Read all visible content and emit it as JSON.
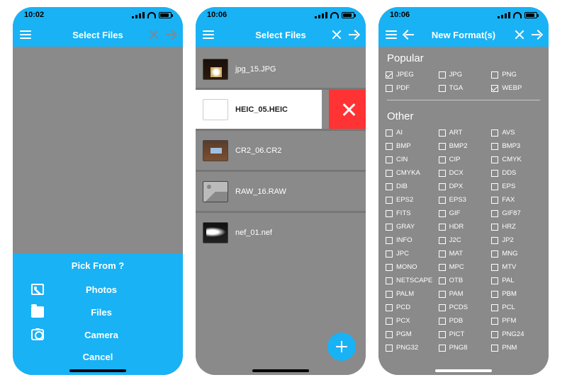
{
  "colors": {
    "accent": "#19b2f5",
    "danger": "#f33",
    "bg": "#8a8a8a"
  },
  "phone1": {
    "time": "10:02",
    "title": "Select Files",
    "sheet": {
      "title": "Pick From ?",
      "photos": "Photos",
      "files": "Files",
      "camera": "Camera",
      "cancel": "Cancel"
    }
  },
  "phone2": {
    "time": "10:06",
    "title": "Select Files",
    "files": [
      {
        "name": "jpg_15.JPG",
        "thumb": "t1"
      },
      {
        "name": "HEIC_05.HEIC",
        "thumb": "white",
        "swiped": true
      },
      {
        "name": "CR2_06.CR2",
        "thumb": "t3"
      },
      {
        "name": "RAW_16.RAW",
        "thumb": "placeholder"
      },
      {
        "name": "nef_01.nef",
        "thumb": "t5"
      }
    ]
  },
  "phone3": {
    "time": "10:06",
    "title": "New Format(s)",
    "section_popular": "Popular",
    "section_other": "Other",
    "popular": [
      {
        "label": "JPEG",
        "checked": true
      },
      {
        "label": "JPG",
        "checked": false
      },
      {
        "label": "PNG",
        "checked": false
      },
      {
        "label": "PDF",
        "checked": false
      },
      {
        "label": "TGA",
        "checked": false
      },
      {
        "label": "WEBP",
        "checked": true
      }
    ],
    "other": [
      {
        "label": "AI"
      },
      {
        "label": "ART"
      },
      {
        "label": "AVS"
      },
      {
        "label": "BMP"
      },
      {
        "label": "BMP2"
      },
      {
        "label": "BMP3"
      },
      {
        "label": "CIN"
      },
      {
        "label": "CIP"
      },
      {
        "label": "CMYK"
      },
      {
        "label": "CMYKA"
      },
      {
        "label": "DCX"
      },
      {
        "label": "DDS"
      },
      {
        "label": "DIB"
      },
      {
        "label": "DPX"
      },
      {
        "label": "EPS"
      },
      {
        "label": "EPS2"
      },
      {
        "label": "EPS3"
      },
      {
        "label": "FAX"
      },
      {
        "label": "FITS"
      },
      {
        "label": "GIF"
      },
      {
        "label": "GIF87"
      },
      {
        "label": "GRAY"
      },
      {
        "label": "HDR"
      },
      {
        "label": "HRZ"
      },
      {
        "label": "INFO"
      },
      {
        "label": "J2C"
      },
      {
        "label": "JP2"
      },
      {
        "label": "JPC"
      },
      {
        "label": "MAT"
      },
      {
        "label": "MNG"
      },
      {
        "label": "MONO"
      },
      {
        "label": "MPC"
      },
      {
        "label": "MTV"
      },
      {
        "label": "NETSCAPE"
      },
      {
        "label": "OTB"
      },
      {
        "label": "PAL"
      },
      {
        "label": "PALM"
      },
      {
        "label": "PAM"
      },
      {
        "label": "PBM"
      },
      {
        "label": "PCD"
      },
      {
        "label": "PCDS"
      },
      {
        "label": "PCL"
      },
      {
        "label": "PCX"
      },
      {
        "label": "PDB"
      },
      {
        "label": "PFM"
      },
      {
        "label": "PGM"
      },
      {
        "label": "PICT"
      },
      {
        "label": "PNG24"
      },
      {
        "label": "PNG32"
      },
      {
        "label": "PNG8"
      },
      {
        "label": "PNM"
      }
    ]
  }
}
